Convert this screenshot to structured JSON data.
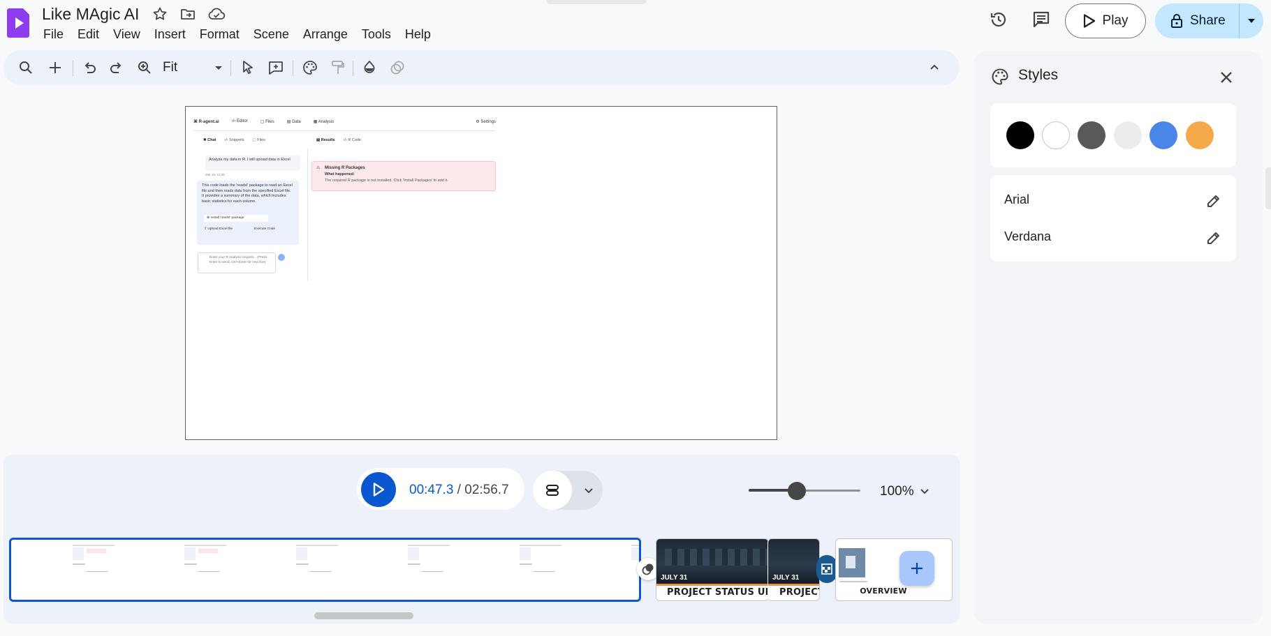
{
  "app": {
    "title": "Like MAgic AI",
    "menu": [
      "File",
      "Edit",
      "View",
      "Insert",
      "Format",
      "Scene",
      "Arrange",
      "Tools",
      "Help"
    ],
    "play_label": "Play",
    "share_label": "Share"
  },
  "toolbar": {
    "zoom_value": "Fit"
  },
  "slide_content": {
    "nav": [
      "R-agent.ai",
      "Editor",
      "Files",
      "Data",
      "Analysis",
      "Settings"
    ],
    "left_tabs": [
      "Chat",
      "Snippets",
      "Files"
    ],
    "right_tabs": [
      "Results",
      "R Code"
    ],
    "user_message": "Analyze my data in R. I will upload data in Excel",
    "message_time": "Mar 16, 12:26",
    "assistant_message": "This code loads the 'readxl' package to read an Excel file and then reads data from the specified Excel file. It provides a summary of the data, which includes basic statistics for each column.",
    "install_action": "Install 'readxl' package",
    "upload_action": "Upload Excel file",
    "execute_action": "Execute Code",
    "input_placeholder": "Enter your R analysis request... (Press Enter to send, Ctrl+Enter for new line)",
    "error_title": "Missing R Packages",
    "error_subtitle": "What happened:",
    "error_body": "The required R package is not installed. Click 'Install Packages' to add it."
  },
  "player": {
    "current_time": "00:47.3",
    "separator": " / ",
    "total_time": "02:56.7",
    "zoom_percent": "100%",
    "zoom_level": 0.43
  },
  "timeline": {
    "clips": [
      {
        "date": "JULY 31",
        "label": "PROJECT STATUS UPDATE"
      },
      {
        "date": "JULY 31",
        "label": "PROJECT ST"
      },
      {
        "label": "OVERVIEW"
      }
    ]
  },
  "styles_panel": {
    "title": "Styles",
    "colors": [
      "#000000",
      "#ffffff",
      "#595959",
      "#ececec",
      "#4a86e8",
      "#f6a94a"
    ],
    "fonts": [
      "Arial",
      "Verdana"
    ]
  }
}
